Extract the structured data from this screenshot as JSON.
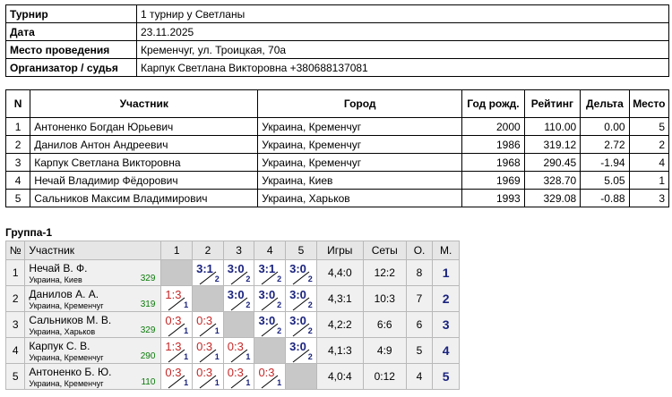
{
  "info": {
    "rows": [
      {
        "label": "Турнир",
        "value": "1 турнир у Светланы"
      },
      {
        "label": "Дата",
        "value": "23.11.2025"
      },
      {
        "label": "Место проведения",
        "value": "Кременчуг, ул. Троицкая, 70а"
      },
      {
        "label": "Организатор / судья",
        "value": "Карпук Светлана Викторовна +380688137081"
      }
    ]
  },
  "participants": {
    "headers": [
      "N",
      "Участник",
      "Город",
      "Год рожд.",
      "Рейтинг",
      "Дельта",
      "Место"
    ],
    "rows": [
      {
        "n": "1",
        "name": "Антоненко Богдан Юрьевич",
        "city": "Украина, Кременчуг",
        "year": "2000",
        "rating": "110.00",
        "delta": "0.00",
        "place": "5"
      },
      {
        "n": "2",
        "name": "Данилов Антон Андреевич",
        "city": "Украина, Кременчуг",
        "year": "1986",
        "rating": "319.12",
        "delta": "2.72",
        "place": "2"
      },
      {
        "n": "3",
        "name": "Карпук Светлана Викторовна",
        "city": "Украина, Кременчуг",
        "year": "1968",
        "rating": "290.45",
        "delta": "-1.94",
        "place": "4"
      },
      {
        "n": "4",
        "name": "Нечай Владимир Фёдорович",
        "city": "Украина, Киев",
        "year": "1969",
        "rating": "328.70",
        "delta": "5.05",
        "place": "1"
      },
      {
        "n": "5",
        "name": "Сальников Максим Владимирович",
        "city": "Украина, Харьков",
        "year": "1993",
        "rating": "329.08",
        "delta": "-0.88",
        "place": "3"
      }
    ]
  },
  "group": {
    "title": "Группа-1",
    "headers": {
      "n": "№",
      "player": "Участник",
      "cols": [
        "1",
        "2",
        "3",
        "4",
        "5"
      ],
      "games": "Игры",
      "sets": "Сеты",
      "points": "О.",
      "place": "М."
    },
    "rows": [
      {
        "n": "1",
        "name": "Нечай В. Ф.",
        "city": "Украина, Киев",
        "rating": "329",
        "results": [
          null,
          {
            "s": "3:1",
            "p": "2",
            "w": true
          },
          {
            "s": "3:0",
            "p": "2",
            "w": true
          },
          {
            "s": "3:1",
            "p": "2",
            "w": true
          },
          {
            "s": "3:0",
            "p": "2",
            "w": true
          }
        ],
        "games": "4,4:0",
        "sets": "12:2",
        "points": "8",
        "place": "1"
      },
      {
        "n": "2",
        "name": "Данилов А. А.",
        "city": "Украина, Кременчуг",
        "rating": "319",
        "results": [
          {
            "s": "1:3",
            "p": "1",
            "w": false
          },
          null,
          {
            "s": "3:0",
            "p": "2",
            "w": true
          },
          {
            "s": "3:0",
            "p": "2",
            "w": true
          },
          {
            "s": "3:0",
            "p": "2",
            "w": true
          }
        ],
        "games": "4,3:1",
        "sets": "10:3",
        "points": "7",
        "place": "2"
      },
      {
        "n": "3",
        "name": "Сальников М. В.",
        "city": "Украина, Харьков",
        "rating": "329",
        "results": [
          {
            "s": "0:3",
            "p": "1",
            "w": false
          },
          {
            "s": "0:3",
            "p": "1",
            "w": false
          },
          null,
          {
            "s": "3:0",
            "p": "2",
            "w": true
          },
          {
            "s": "3:0",
            "p": "2",
            "w": true
          }
        ],
        "games": "4,2:2",
        "sets": "6:6",
        "points": "6",
        "place": "3"
      },
      {
        "n": "4",
        "name": "Карпук С. В.",
        "city": "Украина, Кременчуг",
        "rating": "290",
        "results": [
          {
            "s": "1:3",
            "p": "1",
            "w": false
          },
          {
            "s": "0:3",
            "p": "1",
            "w": false
          },
          {
            "s": "0:3",
            "p": "1",
            "w": false
          },
          null,
          {
            "s": "3:0",
            "p": "2",
            "w": true
          }
        ],
        "games": "4,1:3",
        "sets": "4:9",
        "points": "5",
        "place": "4"
      },
      {
        "n": "5",
        "name": "Антоненко Б. Ю.",
        "city": "Украина, Кременчуг",
        "rating": "110",
        "results": [
          {
            "s": "0:3",
            "p": "1",
            "w": false
          },
          {
            "s": "0:3",
            "p": "1",
            "w": false
          },
          {
            "s": "0:3",
            "p": "1",
            "w": false
          },
          {
            "s": "0:3",
            "p": "1",
            "w": false
          },
          null
        ],
        "games": "4,0:4",
        "sets": "0:12",
        "points": "4",
        "place": "5"
      }
    ]
  },
  "colors": {
    "win": "#1a237e",
    "loss": "#c62828",
    "rating": "#0a7a0a",
    "self_cell": "#c8c8c8",
    "header_bg": "#e6e6e6"
  }
}
